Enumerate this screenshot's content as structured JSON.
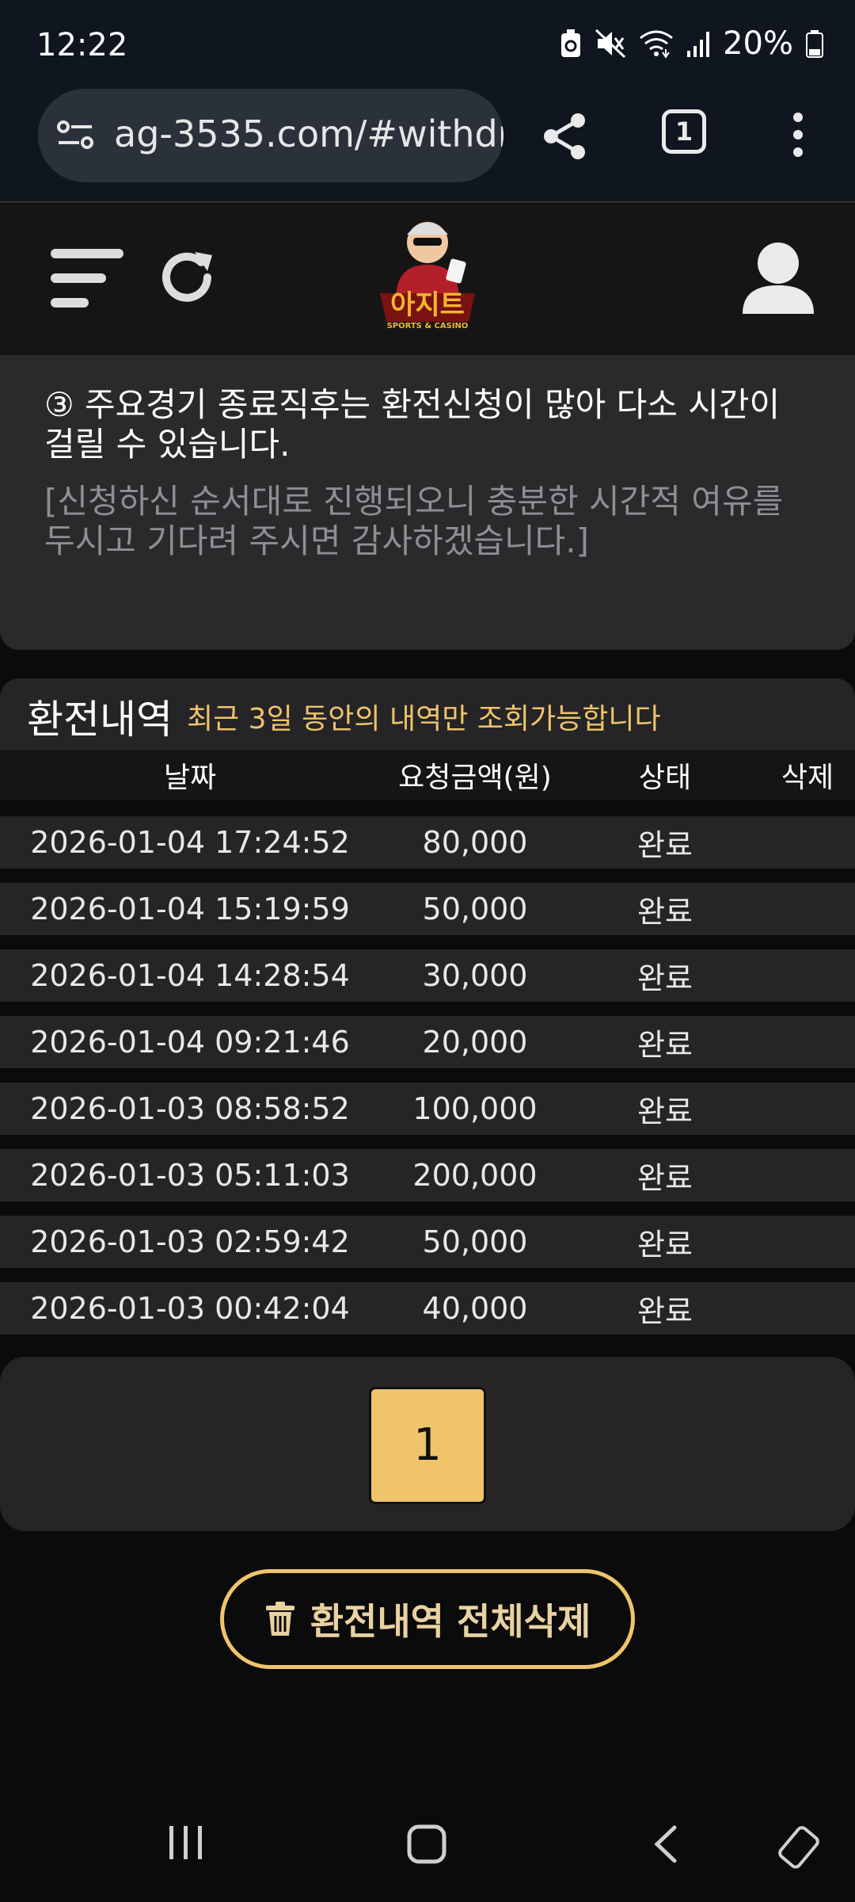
{
  "status_bar": {
    "time": "12:22",
    "battery": "20%",
    "icons": [
      "battery-saver-icon",
      "mute-icon",
      "wifi-icon",
      "signal-icon",
      "battery-icon"
    ]
  },
  "browser": {
    "url": "ag-3535.com/#withdr",
    "tab_count": "1",
    "icons": [
      "site-settings-icon",
      "share-icon",
      "tabs-icon",
      "more-icon"
    ]
  },
  "site_header": {
    "logo_text": "아지트",
    "logo_sub": "SPORTS & CASINO",
    "icons": [
      "menu-icon",
      "refresh-icon",
      "user-icon"
    ]
  },
  "notice": {
    "line1": "③ 주요경기 종료직후는 환전신청이 많아 다소 시간이 걸릴 수 있습니다.",
    "line2": "[신청하신 순서대로 진행되오니 충분한 시간적 여유를 두시고 기다려 주시면 감사하겠습니다.]"
  },
  "history": {
    "title": "환전내역",
    "subtitle": "최근 3일 동안의 내역만 조회가능합니다",
    "columns": [
      "날짜",
      "요청금액(원)",
      "상태",
      "삭제"
    ],
    "rows": [
      {
        "date": "2026-01-04 17:24:52",
        "amount": "80,000",
        "status": "완료"
      },
      {
        "date": "2026-01-04 15:19:59",
        "amount": "50,000",
        "status": "완료"
      },
      {
        "date": "2026-01-04 14:28:54",
        "amount": "30,000",
        "status": "완료"
      },
      {
        "date": "2026-01-04 09:21:46",
        "amount": "20,000",
        "status": "완료"
      },
      {
        "date": "2026-01-03 08:58:52",
        "amount": "100,000",
        "status": "완료"
      },
      {
        "date": "2026-01-03 05:11:03",
        "amount": "200,000",
        "status": "완료"
      },
      {
        "date": "2026-01-03 02:59:42",
        "amount": "50,000",
        "status": "완료"
      },
      {
        "date": "2026-01-03 00:42:04",
        "amount": "40,000",
        "status": "완료"
      }
    ]
  },
  "pagination": {
    "current_page": "1"
  },
  "delete_all": {
    "label": "환전내역 전체삭제",
    "icon": "trash-icon"
  },
  "nav_bar": {
    "icons": [
      "recents-icon",
      "home-icon",
      "back-icon",
      "rotate-icon"
    ]
  },
  "colors": {
    "accent": "#efc46a",
    "background": "#0b0b0b",
    "panel": "#252528"
  }
}
